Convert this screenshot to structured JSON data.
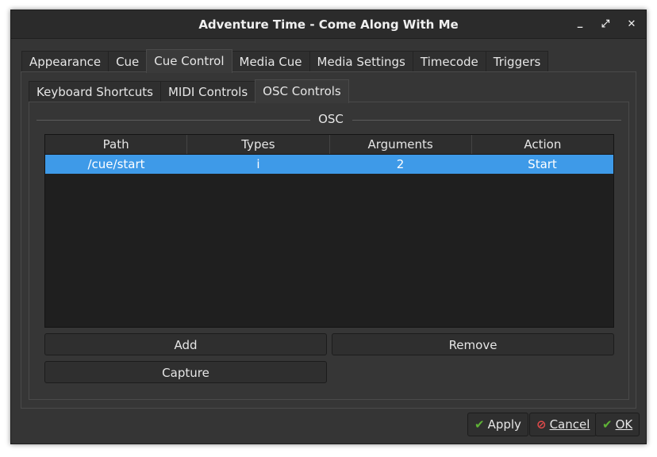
{
  "window": {
    "title": "Adventure Time - Come Along With Me"
  },
  "titlebar_buttons": {
    "minimize": "_",
    "maximize": "⤢",
    "close": "✕"
  },
  "main_tabs": [
    {
      "label": "Appearance",
      "active": false
    },
    {
      "label": "Cue",
      "active": false
    },
    {
      "label": "Cue Control",
      "active": true
    },
    {
      "label": "Media Cue",
      "active": false
    },
    {
      "label": "Media Settings",
      "active": false
    },
    {
      "label": "Timecode",
      "active": false
    },
    {
      "label": "Triggers",
      "active": false
    }
  ],
  "sub_tabs": [
    {
      "label": "Keyboard Shortcuts",
      "active": false
    },
    {
      "label": "MIDI Controls",
      "active": false
    },
    {
      "label": "OSC Controls",
      "active": true
    }
  ],
  "osc_group": {
    "title": "OSC"
  },
  "table": {
    "columns": [
      "Path",
      "Types",
      "Arguments",
      "Action"
    ],
    "rows": [
      {
        "path": "/cue/start",
        "types": "i",
        "arguments": "2",
        "action": "Start",
        "selected": true
      }
    ]
  },
  "buttons": {
    "add": "Add",
    "remove": "Remove",
    "capture": "Capture"
  },
  "dialog_buttons": {
    "apply": {
      "icon": "check-icon",
      "label": "Apply"
    },
    "cancel": {
      "icon": "cancel-icon",
      "label": "Cancel"
    },
    "ok": {
      "icon": "check-icon",
      "label": "OK"
    }
  },
  "colors": {
    "selection": "#3e9ae8",
    "check": "#5fb336",
    "cancel": "#e04a4a",
    "background": "#353535"
  }
}
